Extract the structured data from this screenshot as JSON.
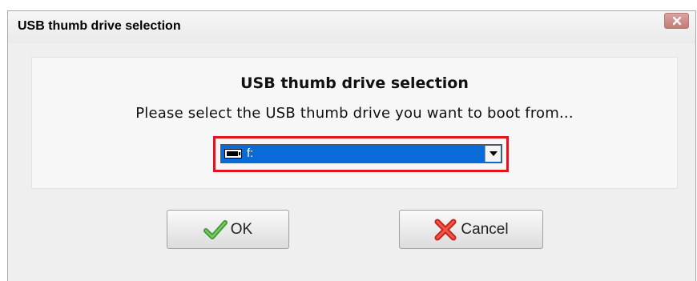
{
  "window": {
    "title": "USB thumb drive selection"
  },
  "panel": {
    "heading": "USB thumb drive selection",
    "message": "Please select the USB thumb drive you want to boot from..."
  },
  "drive_select": {
    "selected_value": "f:",
    "icon": "usb-drive-icon",
    "highlight_color": "#e8121c",
    "selection_color": "#0a6bd8"
  },
  "buttons": {
    "ok_label": "OK",
    "ok_icon": "checkmark-icon",
    "cancel_label": "Cancel",
    "cancel_icon": "red-x-icon"
  }
}
